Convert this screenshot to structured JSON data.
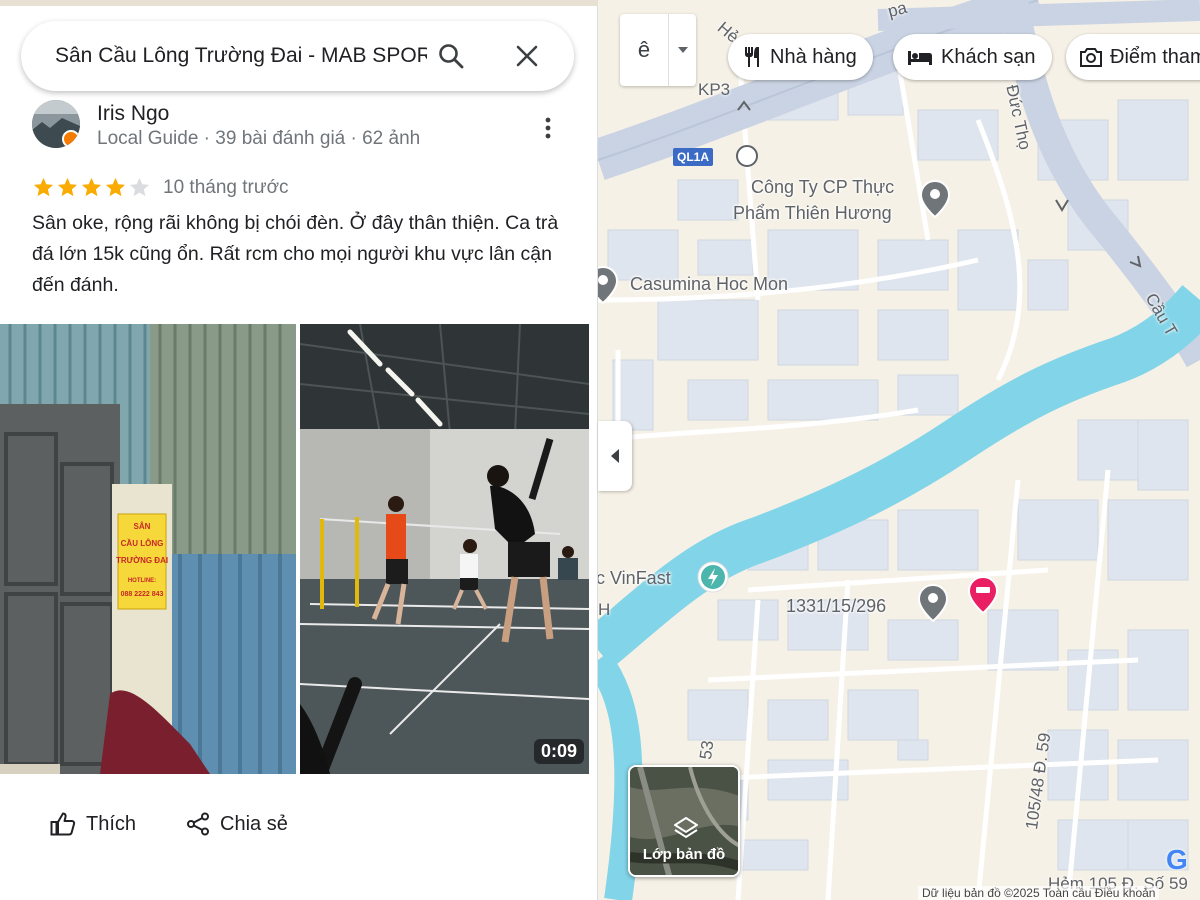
{
  "search": {
    "query": "Sân Cầu Lông Trường Đai - MAB SPORT"
  },
  "review": {
    "name": "Iris Ngo",
    "meta": "Local Guide · 39 bài đánh giá · 62 ảnh",
    "stars": 4,
    "max_stars": 5,
    "time": "10 tháng trước",
    "text": "Sân oke, rộng rãi không bị chói đèn. Ở đây thân thiện. Ca trà đá lớn 15k cũng ổn. Rất rcm cho mọi người khu vực lân cận đến đánh.",
    "video_duration": "0:09",
    "sign_text": [
      "SÂN",
      "CẦU LÔNG",
      "TRƯỜNG ĐAI",
      "HOTLINE:",
      "088 2222 843"
    ]
  },
  "actions": {
    "like": "Thích",
    "share": "Chia sẻ"
  },
  "map": {
    "language": "ê",
    "chips": [
      "Nhà hàng",
      "Khách sạn",
      "Điểm tham quan"
    ],
    "places": {
      "food_company": [
        "Công Ty CP Thực",
        "Phẩm Thiên Hương"
      ],
      "casumina": "Casumina Hoc Mon",
      "vinfast": "c VinFast",
      "address": "1331/15/296"
    },
    "roads": {
      "duc_tho": "Lê Đức Thọ",
      "cau": "Cầu T",
      "kp3": "KP3",
      "d53": "53",
      "d105": "105/48 Đ. 59",
      "hem": "Hẻm 105 Đ. Số 59",
      "he": "Hẻ",
      "pa": "pa",
      "h": "H"
    },
    "ql1a": "QL1A",
    "layers_label": "Lớp bản đồ",
    "footer": "Dữ liệu bản đồ ©2025    Toàn cầu    Điều khoản",
    "google_logo": "G",
    "colors": {
      "land": "#f6f1e6",
      "block": "#dfe5ee",
      "water": "#82d4e8",
      "road": "#ffffff",
      "highway": "#c9d3e3",
      "pin": "#70757a",
      "hotel_pin": "#e91e63"
    }
  }
}
